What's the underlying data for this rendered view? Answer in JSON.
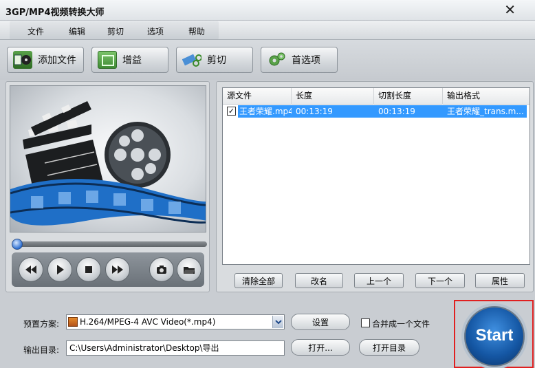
{
  "window": {
    "title": "3GP/MP4视频转换大师",
    "close_glyph": "✕"
  },
  "menu": [
    "文件",
    "编辑",
    "剪切",
    "选项",
    "帮助"
  ],
  "toolbar": {
    "add_file": "添加文件",
    "gain": "增益",
    "cut": "剪切",
    "preferences": "首选项"
  },
  "file_list": {
    "headers": [
      "源文件",
      "长度",
      "切割长度",
      "输出格式"
    ],
    "rows": [
      {
        "checked": true,
        "source": "王者荣耀.mp4",
        "length": "00:13:19",
        "cut_length": "00:13:19",
        "output": "王者荣耀_trans.m..."
      }
    ],
    "buttons": {
      "clear_all": "清除全部",
      "rename": "改名",
      "move_up": "上一个",
      "move_down": "下一个",
      "properties": "属性"
    }
  },
  "preset": {
    "label": "预置方案:",
    "value": "H.264/MPEG-4 AVC Video(*.mp4)",
    "settings_button": "设置",
    "merge_label": "合并成一个文件"
  },
  "output": {
    "label": "输出目录:",
    "path": "C:\\Users\\Administrator\\Desktop\\导出",
    "open_button": "打开...",
    "open_dir_button": "打开目录"
  },
  "start_label": "Start",
  "colors": {
    "selection": "#3399ff",
    "start": "#1456a3",
    "highlight_frame": "#e02020"
  }
}
